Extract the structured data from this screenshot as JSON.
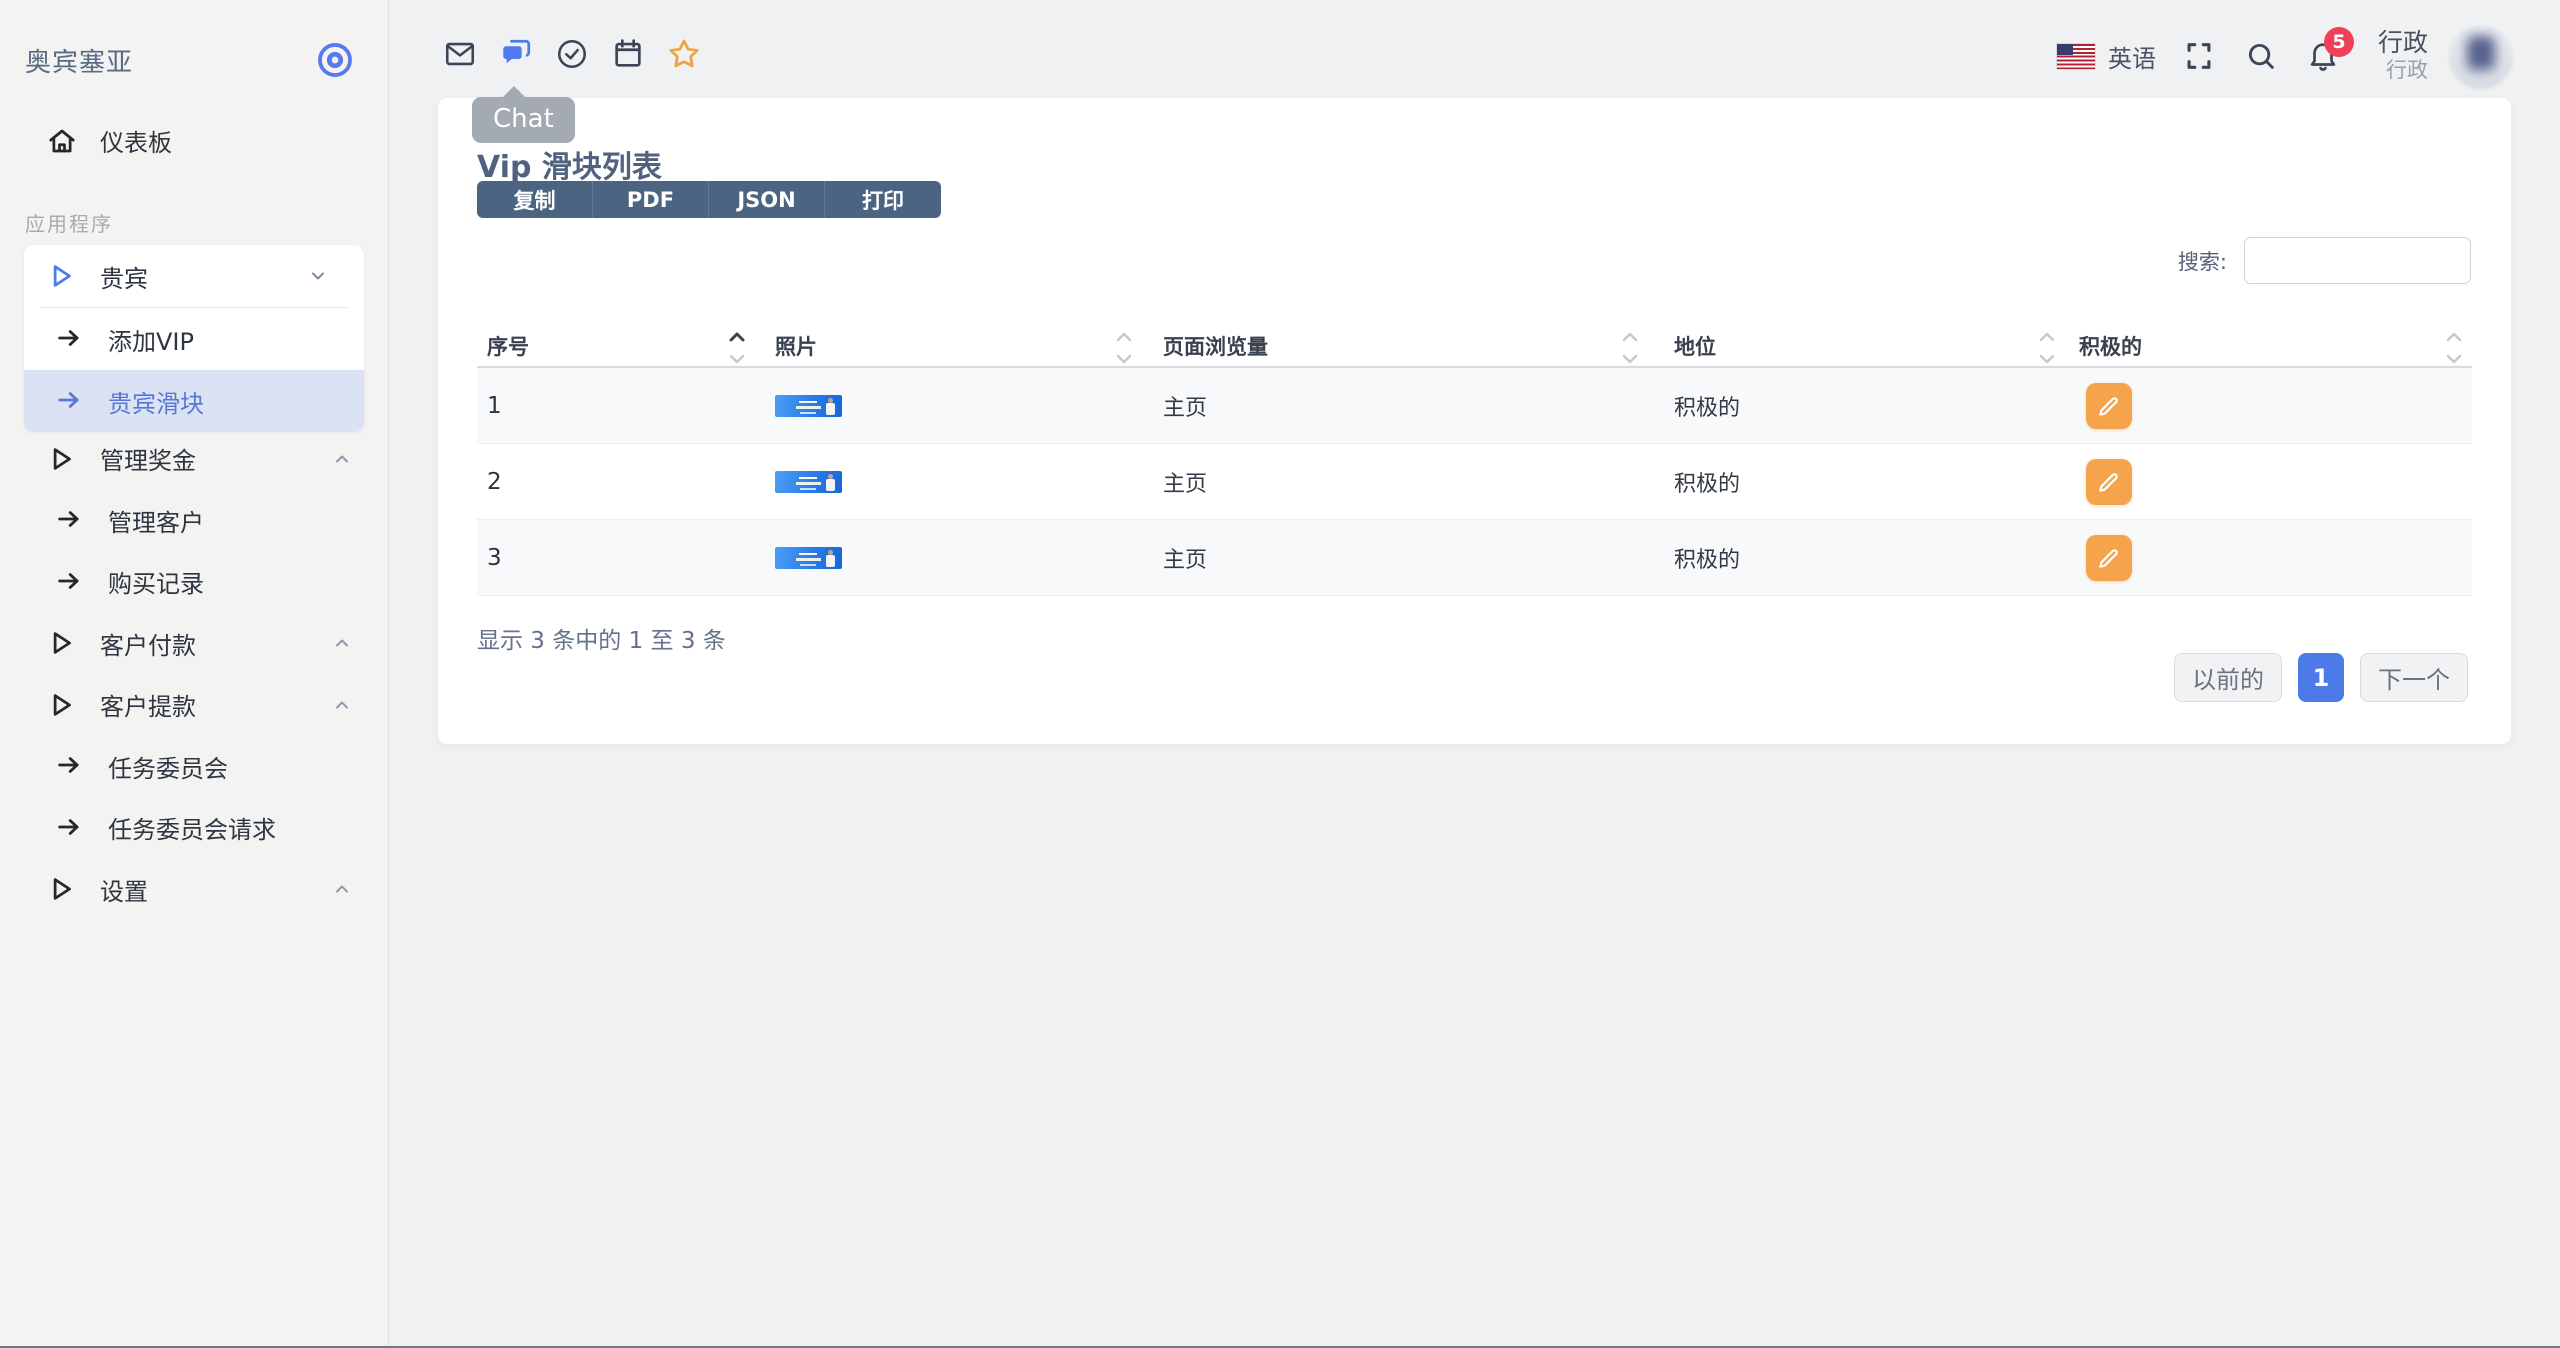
{
  "brand": {
    "name": "奥宾塞亚"
  },
  "sidebar": {
    "dashboard_label": "仪表板",
    "section_label": "应用程序",
    "group": {
      "label": "贵宾",
      "items": [
        {
          "label": "添加VIP"
        },
        {
          "label": "贵宾滑块"
        }
      ]
    },
    "items": [
      {
        "label": "管理奖金"
      },
      {
        "label": "管理客户"
      },
      {
        "label": "购买记录"
      },
      {
        "label": "客户付款"
      },
      {
        "label": "客户提款"
      },
      {
        "label": "任务委员会"
      },
      {
        "label": "任务委员会请求"
      },
      {
        "label": "设置"
      }
    ]
  },
  "topbar": {
    "chat_tooltip": "Chat",
    "language": "英语",
    "notification_count": "5",
    "user_name": "行政",
    "user_role": "行政"
  },
  "main": {
    "title": "Vip 滑块列表",
    "buttons": {
      "copy": "复制",
      "pdf": "PDF",
      "json": "JSON",
      "print": "打印"
    },
    "search_label": "搜索:",
    "table": {
      "columns": [
        "序号",
        "照片",
        "页面浏览量",
        "地位",
        "积极的"
      ],
      "rows": [
        {
          "serial": "1",
          "page_view": "主页",
          "status": "积极的"
        },
        {
          "serial": "2",
          "page_view": "主页",
          "status": "积极的"
        },
        {
          "serial": "3",
          "page_view": "主页",
          "status": "积极的"
        }
      ]
    },
    "summary": "显示 3 条中的 1 至 3 条",
    "pagination": {
      "previous": "以前的",
      "current": "1",
      "next": "下一个"
    }
  },
  "colors": {
    "accent": "#4c7be8",
    "toolbar_button": "#4a6482",
    "edit_button": "#f6a44c",
    "badge": "#ef4058",
    "star": "#f0a33c",
    "selected_item_bg": "#dbe2f3"
  }
}
